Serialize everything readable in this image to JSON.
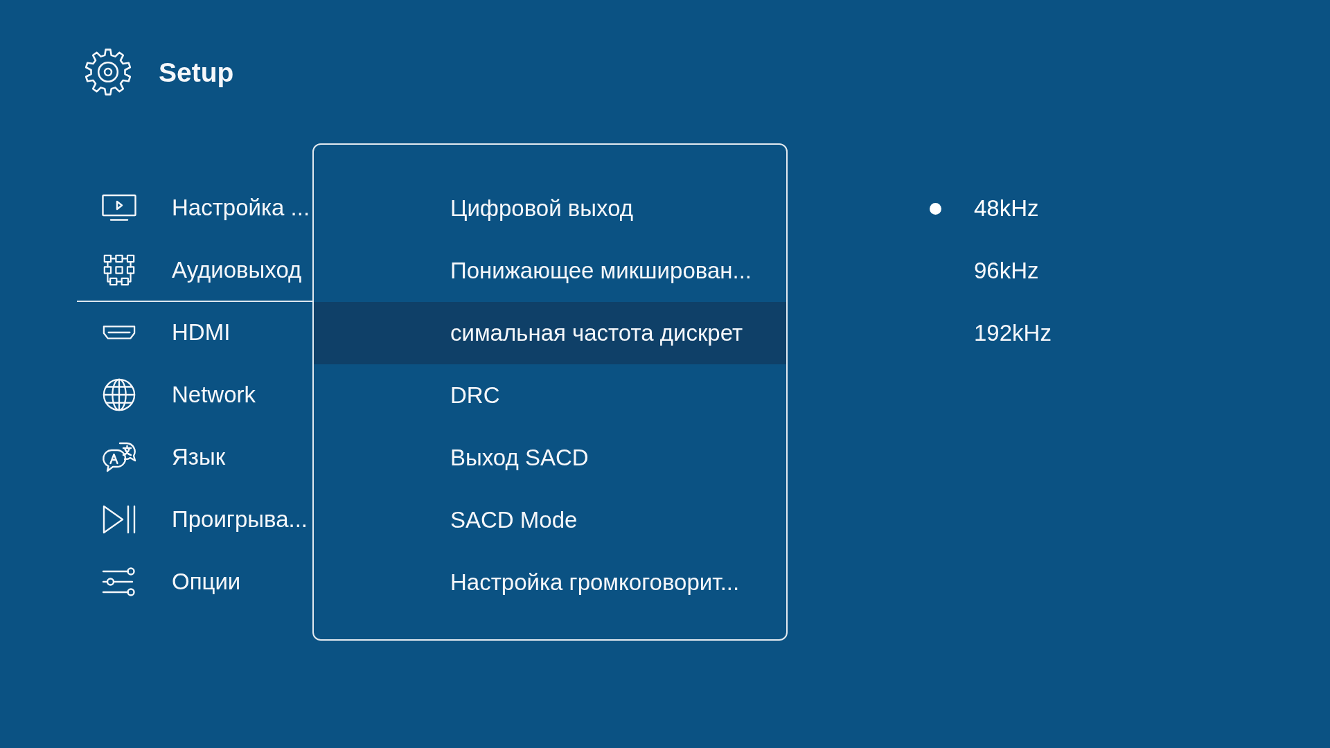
{
  "header": {
    "title": "Setup"
  },
  "sidebar": {
    "items": [
      {
        "kind": "display",
        "label": "Настройка ...",
        "selected": false
      },
      {
        "kind": "audio",
        "label": "Аудиовыход",
        "selected": true
      },
      {
        "kind": "hdmi",
        "label": "HDMI",
        "selected": false
      },
      {
        "kind": "network",
        "label": "Network",
        "selected": false
      },
      {
        "kind": "language",
        "label": "Язык",
        "selected": false
      },
      {
        "kind": "playback",
        "label": "Проигрыва...",
        "selected": false
      },
      {
        "kind": "options",
        "label": "Опции",
        "selected": false
      }
    ]
  },
  "submenu": {
    "items": [
      {
        "label": "Цифровой выход",
        "selected": false
      },
      {
        "label": "Понижающее микширован...",
        "selected": false
      },
      {
        "label": "симальная частота дискрет",
        "selected": true
      },
      {
        "label": "DRC",
        "selected": false
      },
      {
        "label": "Выход SACD",
        "selected": false
      },
      {
        "label": "SACD Mode",
        "selected": false
      },
      {
        "label": "Настройка громкоговорит...",
        "selected": false
      }
    ]
  },
  "options": [
    {
      "label": "48kHz",
      "selected": true
    },
    {
      "label": "96kHz",
      "selected": false
    },
    {
      "label": "192kHz",
      "selected": false
    }
  ]
}
